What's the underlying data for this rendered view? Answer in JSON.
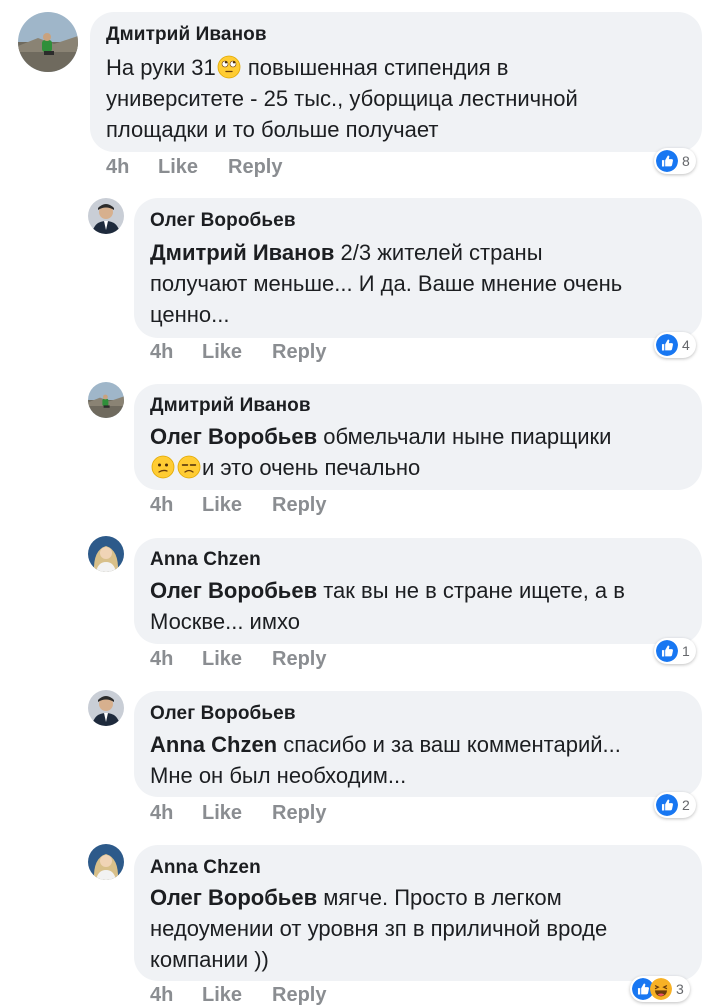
{
  "actions": {
    "time": "4h",
    "like": "Like",
    "reply": "Reply"
  },
  "comments": [
    {
      "author": "Дмитрий Иванов",
      "line1_before": "На руки 31",
      "line1_emoji": "rolling-eyes",
      "line1_after": " повышенная стипендия в",
      "line2": "университете - 25 тыс., уборщица лестничной",
      "line3": "площадки и то больше получает",
      "reactions": {
        "icon": "like",
        "count": "8"
      }
    },
    {
      "author": "Олег Воробьев",
      "mention": "Дмитрий Иванов",
      "line1": " 2/3 жителей страны",
      "line2": "получают меньше... И да. Ваше мнение очень",
      "line3": "ценно...",
      "reactions": {
        "icon": "like",
        "count": "4"
      }
    },
    {
      "author": "Дмитрий Иванов",
      "mention": "Олег Воробьев",
      "line1": " обмельчали ныне пиарщики",
      "emojis": [
        "confused-face",
        "unamused-face"
      ],
      "line2": "и это очень печально"
    },
    {
      "author": "Anna  Chzen",
      "mention": "Олег Воробьев",
      "line1": " так вы не в стране ищете, а в",
      "line2": "Москве... имхо",
      "reactions": {
        "icon": "like",
        "count": "1"
      }
    },
    {
      "author": "Олег Воробьев",
      "mention": "Anna  Chzen",
      "line1": " спасибо и за ваш комментарий...",
      "line2": "Мне он был необходим...",
      "reactions": {
        "icon": "like",
        "count": "2"
      }
    },
    {
      "author": "Anna  Chzen",
      "mention": "Олег Воробьев",
      "line1": " мягче. Просто в легком",
      "line2": "недоумении от уровня зп в приличной вроде",
      "line3": "компании ))",
      "reactions": {
        "icons": [
          "like",
          "haha"
        ],
        "count": "3"
      }
    }
  ],
  "colors": {
    "bubble": "#f0f2f5",
    "meta": "#8a8d91",
    "like_blue": "#1877f2",
    "haha_yellow": "#f7b125"
  }
}
